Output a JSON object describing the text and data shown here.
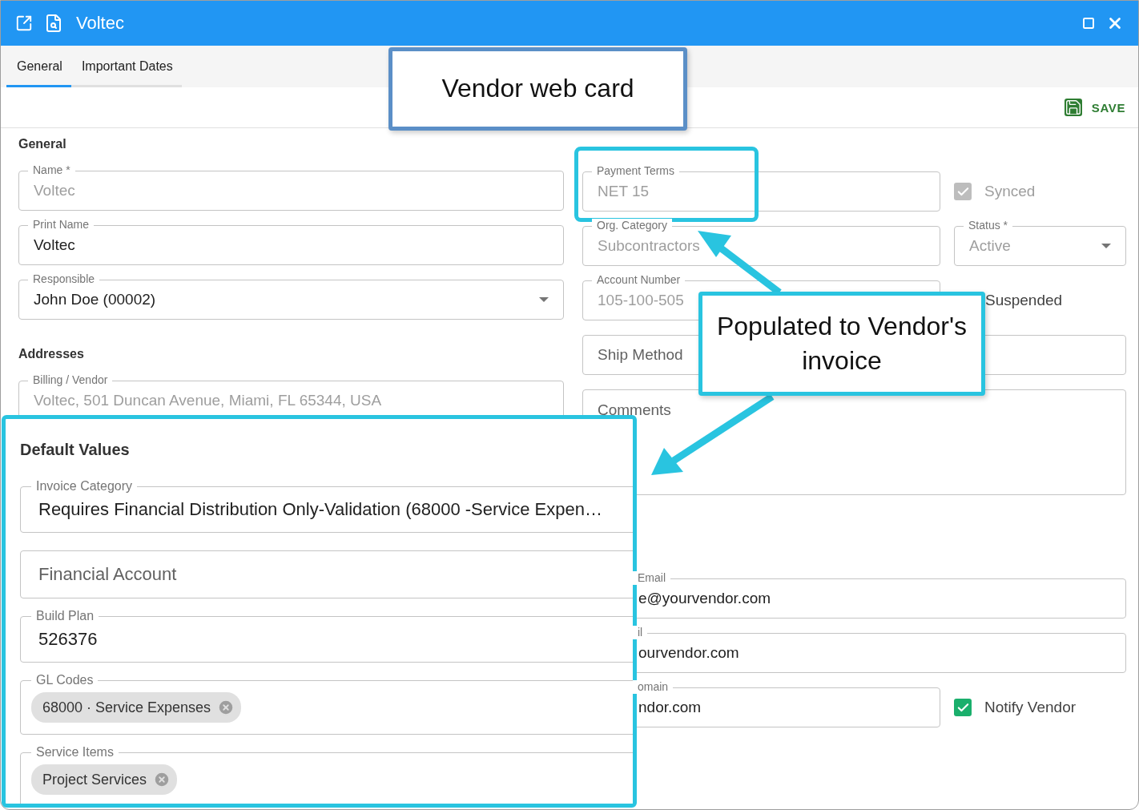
{
  "window": {
    "title": "Voltec"
  },
  "tabs": [
    {
      "label": "General",
      "selected": true
    },
    {
      "label": "Important Dates",
      "selected": false
    }
  ],
  "toolbar": {
    "save_label": "SAVE"
  },
  "general": {
    "heading": "General",
    "fields": [
      {
        "label": "Name *",
        "value": "Voltec",
        "disabled": true
      },
      {
        "label": "Print Name",
        "value": "Voltec",
        "disabled": false
      },
      {
        "label": "Responsible",
        "value": "John Doe (00002)",
        "disabled": false,
        "kind": "select"
      }
    ]
  },
  "addresses": {
    "heading": "Addresses",
    "fields": [
      {
        "label": "Billing / Vendor",
        "value": "Voltec, 501  Duncan Avenue, Miami, FL 65344, USA",
        "disabled": true
      }
    ]
  },
  "details": {
    "payment_terms": {
      "label": "Payment Terms",
      "value": "NET 15",
      "disabled": true
    },
    "synced": {
      "label": "Synced",
      "checked": true,
      "disabled": true
    },
    "org_category": {
      "label": "Org. Category",
      "value": "Subcontractors",
      "disabled": true
    },
    "status": {
      "label": "Status *",
      "value": "Active",
      "disabled": true
    },
    "account_number": {
      "label": "Account Number",
      "value": "105-100-505",
      "disabled": true
    },
    "suspended": {
      "label": "Suspended"
    },
    "ship_method": {
      "placeholder": "Ship Method"
    },
    "comments": {
      "placeholder": "Comments"
    },
    "contact_fields": [
      {
        "label": "Email",
        "value": "e@yourvendor.com"
      },
      {
        "label": "il",
        "value": "ourvendor.com"
      },
      {
        "label": "omain",
        "value": "ndor.com"
      }
    ],
    "notify_vendor": {
      "label": "Notify Vendor",
      "checked": true,
      "disabled": false
    }
  },
  "default_values": {
    "heading": "Default Values",
    "fields": [
      {
        "kind": "text",
        "label": "Invoice Category",
        "value": "Requires Financial Distribution Only-Validation (68000 -Service Expen…"
      },
      {
        "kind": "text",
        "placeholder": "Financial Account"
      },
      {
        "kind": "text",
        "label": "Build Plan",
        "value": "526376"
      },
      {
        "kind": "chips",
        "label": "GL Codes",
        "chips": [
          "68000 · Service Expenses"
        ]
      },
      {
        "kind": "chips",
        "label": "Service Items",
        "chips": [
          "Project Services"
        ]
      }
    ]
  },
  "callouts": [
    {
      "text": "Vendor web card"
    },
    {
      "text": "Populated to Vendor's invoice"
    }
  ]
}
